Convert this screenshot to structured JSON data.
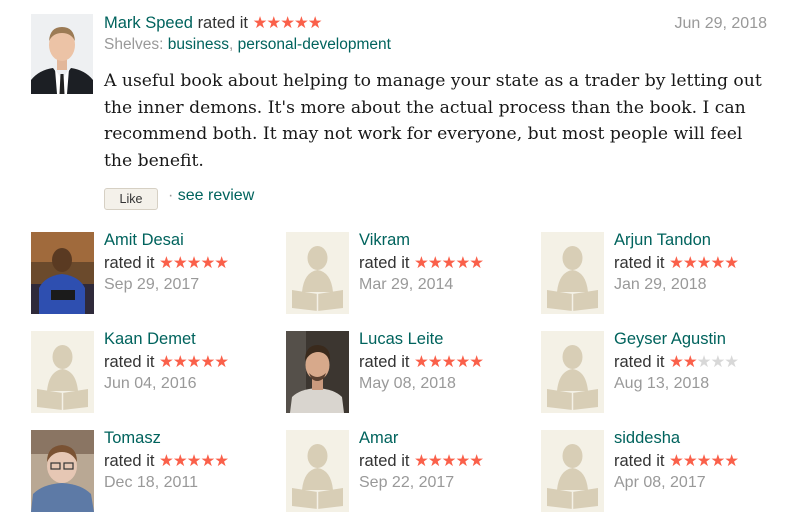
{
  "colors": {
    "link": "#00635d",
    "star_on": "#fa604a",
    "star_off": "#d8d8d8",
    "muted": "#999999",
    "placeholder_bg": "#f4f1e6",
    "placeholder_fg": "#d8ceb6"
  },
  "review": {
    "reviewer_name": "Mark Speed",
    "rated_label": "rated it",
    "stars": 5,
    "shelves_label": "Shelves:",
    "shelves": [
      "business",
      "personal-development"
    ],
    "shelves_separator": ",",
    "date": "Jun 29, 2018",
    "body": "A useful book about helping to manage your state as a trader by letting out the inner demons. It's more about the actual process than the book. I can recommend both. It may not work for everyone, but most people will feel the benefit.",
    "like_label": "Like",
    "see_review_prefix": "·",
    "see_review_label": "see review"
  },
  "raters": [
    {
      "name": "Amit Desai",
      "rated_label": "rated it",
      "stars": 5,
      "date": "Sep 29, 2017",
      "avatar": "photo-man-blue-shirt"
    },
    {
      "name": "Vikram",
      "rated_label": "rated it",
      "stars": 5,
      "date": "Mar 29, 2014",
      "avatar": "placeholder-reader-icon"
    },
    {
      "name": "Arjun Tandon",
      "rated_label": "rated it",
      "stars": 5,
      "date": "Jan 29, 2018",
      "avatar": "placeholder-reader-icon"
    },
    {
      "name": "Kaan Demet",
      "rated_label": "rated it",
      "stars": 5,
      "date": "Jun 04, 2016",
      "avatar": "placeholder-reader-icon"
    },
    {
      "name": "Lucas Leite",
      "rated_label": "rated it",
      "stars": 5,
      "date": "May 08, 2018",
      "avatar": "photo-man-smiling"
    },
    {
      "name": "Geyser Agustin",
      "rated_label": "rated it",
      "stars": 2,
      "date": "Aug 13, 2018",
      "avatar": "placeholder-reader-icon"
    },
    {
      "name": "Tomasz",
      "rated_label": "rated it",
      "stars": 5,
      "date": "Dec 18, 2011",
      "avatar": "photo-boy"
    },
    {
      "name": "Amar",
      "rated_label": "rated it",
      "stars": 5,
      "date": "Sep 22, 2017",
      "avatar": "placeholder-reader-icon"
    },
    {
      "name": "siddesha",
      "rated_label": "rated it",
      "stars": 5,
      "date": "Apr 08, 2017",
      "avatar": "placeholder-reader-icon"
    }
  ]
}
